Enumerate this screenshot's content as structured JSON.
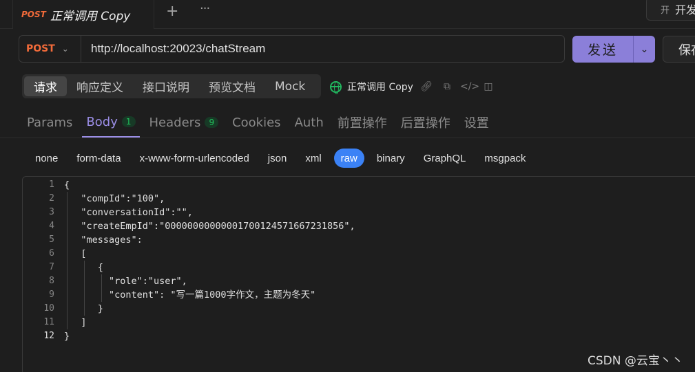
{
  "tab": {
    "method": "POST",
    "name": "正常调用 Copy",
    "add_icon": "+",
    "more_icon": "···"
  },
  "env": {
    "icon": "开",
    "label": "开发"
  },
  "request": {
    "method": "POST",
    "url": "http://localhost:20023/chatStream"
  },
  "actions": {
    "send_label": "发送",
    "save_label": "保存"
  },
  "segments": [
    {
      "label": "请求",
      "active": true
    },
    {
      "label": "响应定义"
    },
    {
      "label": "接口说明"
    },
    {
      "label": "预览文档"
    },
    {
      "label": "Mock"
    }
  ],
  "api_name": "正常调用 Copy",
  "subtabs": [
    {
      "label": "Params"
    },
    {
      "label": "Body",
      "count": "1",
      "active": true
    },
    {
      "label": "Headers",
      "count": "9"
    },
    {
      "label": "Cookies"
    },
    {
      "label": "Auth"
    },
    {
      "label": "前置操作"
    },
    {
      "label": "后置操作"
    },
    {
      "label": "设置"
    }
  ],
  "body_types": [
    "none",
    "form-data",
    "x-www-form-urlencoded",
    "json",
    "xml",
    "raw",
    "binary",
    "GraphQL",
    "msgpack"
  ],
  "active_body_type": "raw",
  "editor": {
    "line_numbers": [
      "1",
      "2",
      "3",
      "4",
      "5",
      "6",
      "7",
      "8",
      "9",
      "10",
      "11",
      "12"
    ],
    "current_line": "12",
    "lines": [
      "{",
      "   \"compId\":\"100\",",
      "   \"conversationId\":\"\",",
      "   \"createEmpId\":\"00000000000001700124571667231856\",",
      "   \"messages\":",
      "   [",
      "      {",
      "        \"role\":\"user\",",
      "        \"content\": \"写一篇1000字作文，主题为冬天\"",
      "      }",
      "   ]",
      "}"
    ]
  },
  "watermark": "CSDN @云宝丶丶",
  "colors": {
    "accent": "#8b7fd9",
    "method": "#f26b3a",
    "raw_active": "#3b82f6",
    "globe": "#22b75f"
  }
}
